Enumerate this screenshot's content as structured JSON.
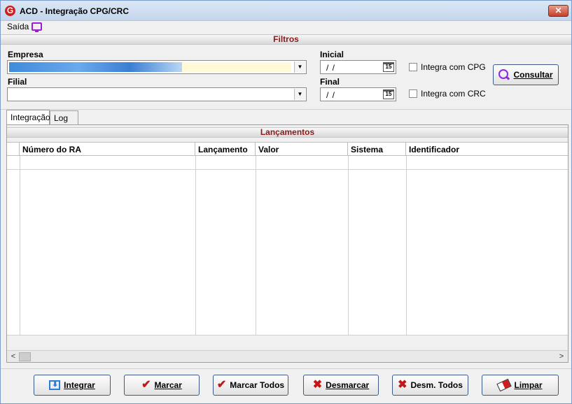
{
  "window": {
    "title": "ACD - Integração CPG/CRC",
    "close_label": "✕"
  },
  "menu": {
    "saida": "Saída"
  },
  "filtros": {
    "header": "Filtros",
    "empresa_label": "Empresa",
    "filial_label": "Filial",
    "inicial_label": "Inicial",
    "final_label": "Final",
    "inicial_value": "/ /",
    "final_value": "/ /",
    "calendar_label": "15",
    "integra_cpg": "Integra com CPG",
    "integra_crc": "Integra com CRC",
    "consultar": "Consultar",
    "dropdown_arrow": "▼"
  },
  "tabs": [
    {
      "label": "Integração"
    },
    {
      "label": "Log"
    }
  ],
  "lancamentos": {
    "header": "Lançamentos",
    "columns": [
      "Número do RA",
      "Lançamento",
      "Valor",
      "Sistema",
      "Identificador"
    ]
  },
  "scroll": {
    "left": "<",
    "right": ">"
  },
  "buttons": {
    "integrar": "Integrar",
    "marcar": "Marcar",
    "marcar_todos": "Marcar Todos",
    "desmarcar": "Desmarcar",
    "desm_todos": "Desm. Todos",
    "limpar": "Limpar"
  },
  "colors": {
    "accent": "#8b1a1a",
    "border": "#3c5a8a"
  }
}
